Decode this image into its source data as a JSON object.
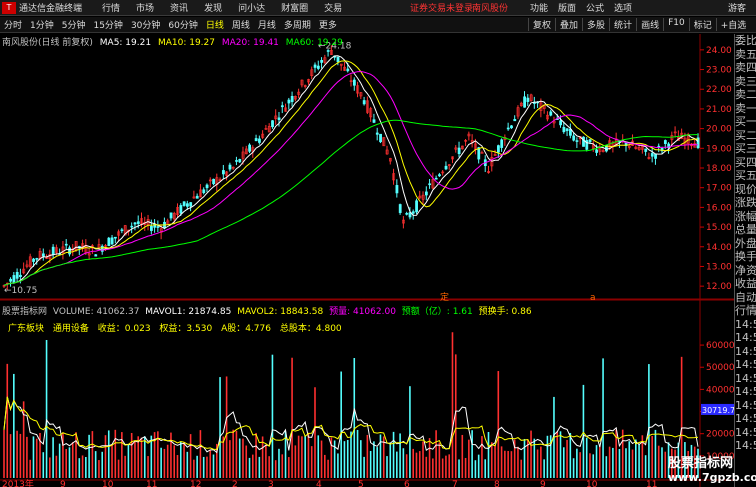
{
  "menubar": {
    "app_title": "通达信金融终端",
    "items": [
      "行情",
      "市场",
      "资讯",
      "发现",
      "问小达",
      "财富圈",
      "交易"
    ],
    "notice": "证券交易未登录",
    "stock_name_alert": "南风股份",
    "right_items": [
      "功能",
      "版面",
      "公式",
      "选项"
    ],
    "guest": "游客"
  },
  "toolbar": {
    "periods": [
      "分时",
      "1分钟",
      "5分钟",
      "15分钟",
      "30分钟",
      "60分钟",
      "日线",
      "周线",
      "月线",
      "多周期",
      "更多"
    ],
    "active_period": "日线",
    "right_tools": [
      "复权",
      "叠加",
      "多股",
      "统计",
      "画线",
      "F10",
      "标记",
      "+自选"
    ]
  },
  "main_chart": {
    "title": "南风股份(日线 前复权)",
    "ma_labels": [
      {
        "text": "MA5: 19.21",
        "color": "#ffffff"
      },
      {
        "text": "MA10: 19.27",
        "color": "#ffff00"
      },
      {
        "text": "MA20: 19.41",
        "color": "#ff00ff"
      },
      {
        "text": "MA60: 19.29",
        "color": "#00ff00"
      }
    ],
    "high_label": "24.18",
    "low_label": "10.75",
    "price_ticks": [
      "24.00",
      "23.00",
      "22.00",
      "21.00",
      "20.00",
      "19.00",
      "18.00",
      "17.00",
      "16.00",
      "15.00",
      "14.00",
      "13.00",
      "12.00"
    ],
    "marker_a": "定",
    "marker_b": "a"
  },
  "volume_chart": {
    "title": "股票指标网",
    "labels": [
      {
        "text": "VOLUME: 41062.37",
        "color": "#c0c0c0"
      },
      {
        "text": "MAVOL1: 21874.85",
        "color": "#ffffff"
      },
      {
        "text": "MAVOL2: 18843.58",
        "color": "#ffff00"
      },
      {
        "text": "预量: 41062.00",
        "color": "#ff00ff"
      },
      {
        "text": "预额（亿）: 1.61",
        "color": "#00ff00"
      },
      {
        "text": "预换手: 0.86",
        "color": "#ffff00"
      }
    ],
    "info_row": [
      {
        "text": "广东板块",
        "color": "#ffff00"
      },
      {
        "text": "通用设备",
        "color": "#ffff00"
      },
      {
        "text": "收益：0.023",
        "color": "#ffff00"
      },
      {
        "text": "权益：3.530",
        "color": "#ffff00"
      },
      {
        "text": "A股：4.776",
        "color": "#ffff00"
      },
      {
        "text": "总股本：4.800",
        "color": "#ffff00"
      }
    ],
    "vol_ticks": [
      "60000",
      "50000",
      "40000",
      "30000",
      "20000",
      "10000"
    ],
    "current_vol_badge": "30719.77",
    "months": [
      "2013年",
      "9",
      "10",
      "11",
      "12",
      "2",
      "3",
      "4",
      "5",
      "6",
      "7",
      "8",
      "9",
      "10",
      "11"
    ]
  },
  "right_panel": {
    "items": [
      "委比",
      "卖五",
      "卖四",
      "卖三",
      "卖二",
      "卖一",
      "买一",
      "买二",
      "买三",
      "买四",
      "买五",
      "现价",
      "涨跌",
      "涨幅",
      "总量",
      "外盘",
      "换手",
      "净资",
      "收益",
      "自动",
      "行情",
      "14:5",
      "14:5",
      "14:5",
      "14:5",
      "14:5",
      "14:5",
      "14:5",
      "14:5",
      "14:5",
      "14:5"
    ]
  },
  "watermark": {
    "line1": "股票指标网",
    "line2": "www.7gpzb.com"
  },
  "colors": {
    "up": "#ff3030",
    "down": "#54ffff",
    "ma5": "#ffffff",
    "ma10": "#ffff00",
    "ma20": "#ff00ff",
    "ma60": "#00ff00"
  }
}
